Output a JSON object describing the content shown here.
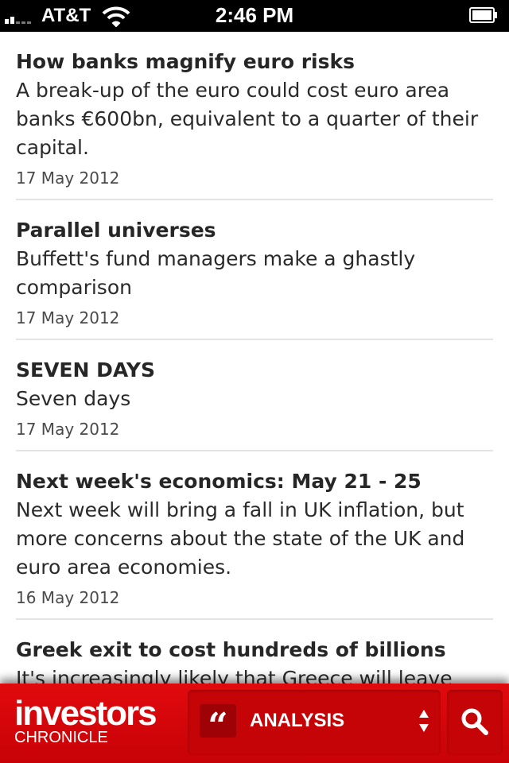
{
  "status_bar": {
    "carrier": "AT&T",
    "time": "2:46 PM"
  },
  "articles": [
    {
      "title": "How banks magnify euro risks",
      "summary": "A break-up of the euro could cost euro area banks €600bn, equivalent to a quarter of their capital.",
      "date": "17 May 2012"
    },
    {
      "title": "Parallel universes",
      "summary": "Buffett's fund managers make a ghastly comparison",
      "date": "17 May 2012"
    },
    {
      "title": "SEVEN DAYS",
      "summary": "Seven days",
      "date": "17 May 2012"
    },
    {
      "title": "Next week's economics: May 21 - 25",
      "summary": "Next week will bring a fall in UK inflation, but more concerns about the state of the UK and euro area economies.",
      "date": "16 May 2012"
    },
    {
      "title": "Greek exit to cost hundreds of billions",
      "summary": "It's increasingly likely that Greece will leave",
      "date": ""
    }
  ],
  "bottom_bar": {
    "logo_main": "investors",
    "logo_sub": "CHRONICLE",
    "section_label": "ANALYSIS",
    "quote_glyph": "“",
    "icons": {
      "section": "quote-icon",
      "selector": "up-down-arrows-icon",
      "search": "search-icon"
    }
  },
  "colors": {
    "brand_red": "#d4060b",
    "status_bar": "#000000",
    "text": "#262626",
    "divider": "#e4e4e4"
  }
}
